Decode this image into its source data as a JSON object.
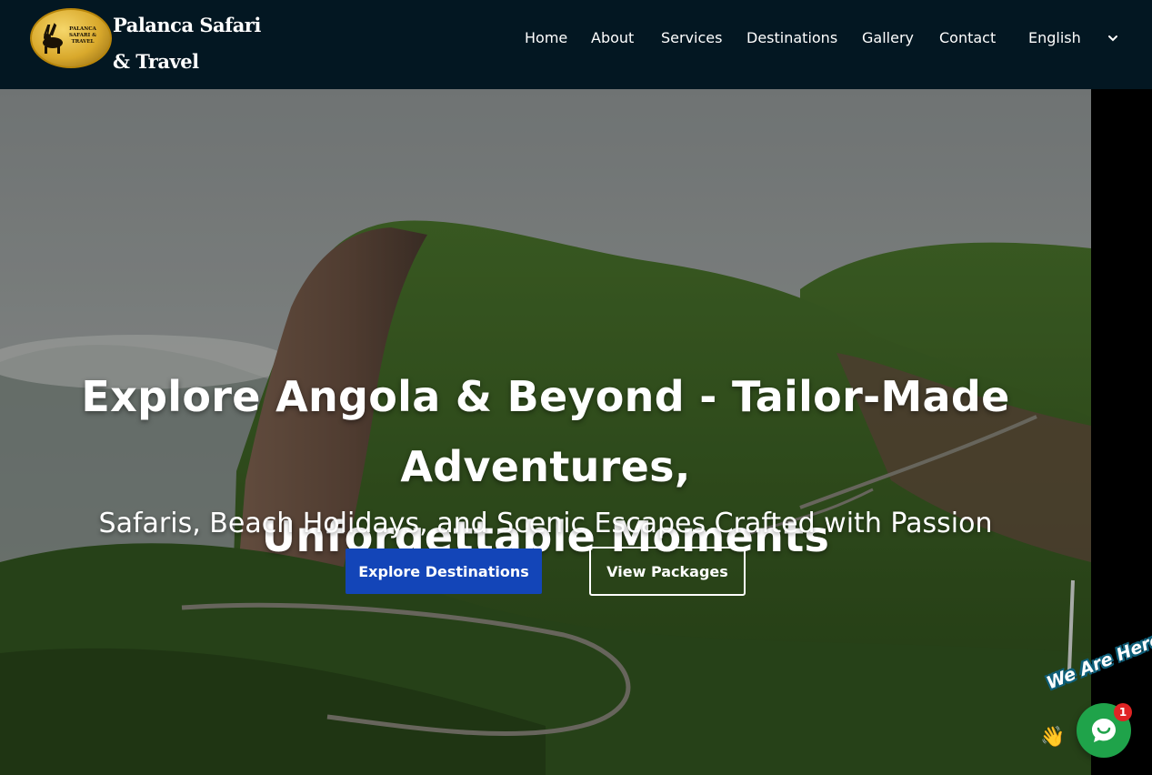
{
  "header": {
    "logo_line1": "Palanca Safari",
    "logo_line2": "& Travel",
    "logo_badge_text": "PALANCA SAFARI & TRAVEL"
  },
  "nav": {
    "items": [
      "Home",
      "About",
      "Services",
      "Destinations",
      "Gallery",
      "Contact"
    ],
    "language": "English"
  },
  "hero": {
    "title_line1": "Explore Angola & Beyond - Tailor-Made Adventures,",
    "title_line2": "Unforgettable Moments",
    "subtitle": "Safaris, Beach Holidays, and Scenic Escapes Crafted with Passion",
    "primary_button": "Explore Destinations",
    "secondary_button": "View Packages"
  },
  "chat": {
    "tagline": "We Are Here!",
    "unread_count": "1",
    "icon": "chat-bubble-icon"
  },
  "colors": {
    "header_bg": "#031722",
    "primary_button": "#1345b8",
    "chat_green": "#1fa34a",
    "badge_red": "#e02424"
  }
}
